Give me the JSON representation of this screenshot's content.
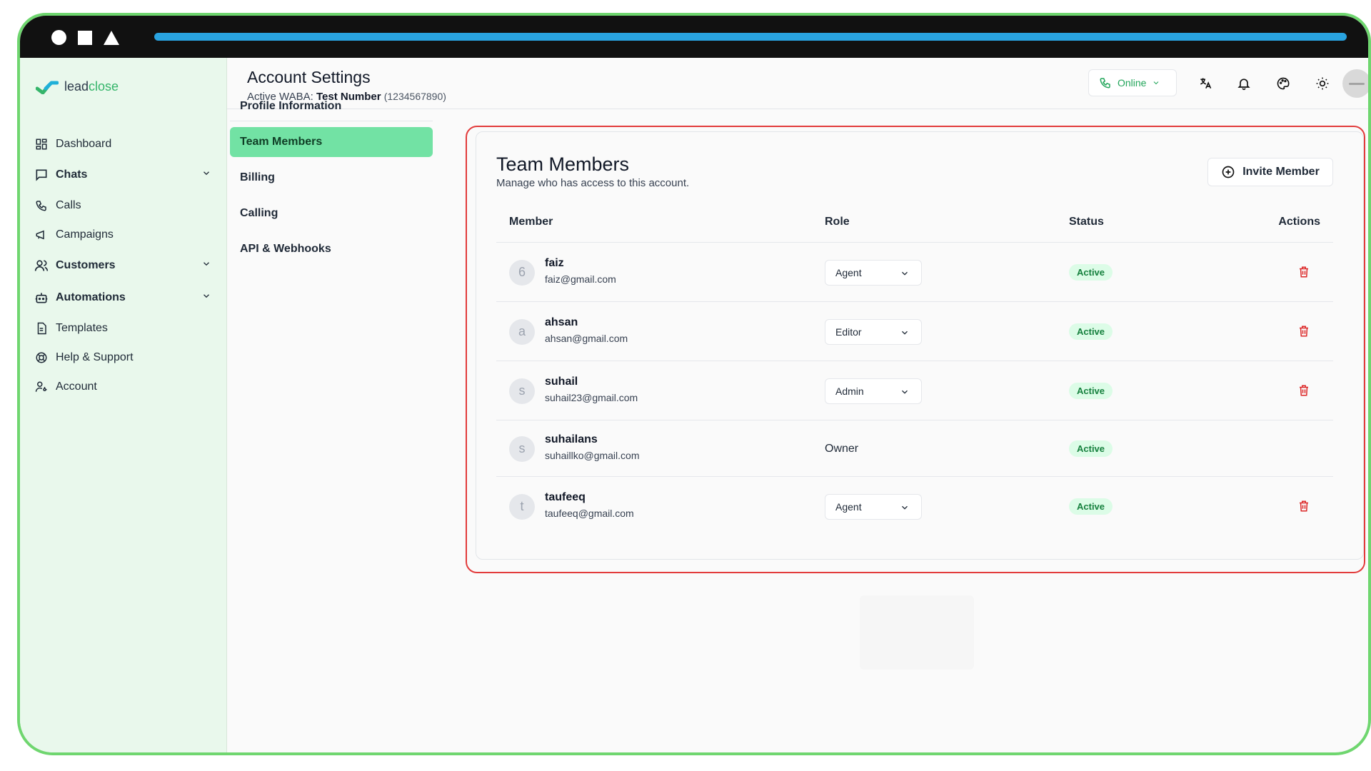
{
  "window": {
    "accent_bar_color": "#29a3e0",
    "frame_color": "#6fd66f"
  },
  "sidebar": {
    "logo": {
      "part1": "lead",
      "part2": "close"
    },
    "items": [
      {
        "label": "Dashboard",
        "icon": "grid-icon",
        "bold": false,
        "chevron": false
      },
      {
        "label": "Chats",
        "icon": "chat-icon",
        "bold": true,
        "chevron": true
      },
      {
        "label": "Calls",
        "icon": "phone-icon",
        "bold": false,
        "chevron": false
      },
      {
        "label": "Campaigns",
        "icon": "megaphone-icon",
        "bold": false,
        "chevron": false
      },
      {
        "label": "Customers",
        "icon": "users-icon",
        "bold": true,
        "chevron": true
      },
      {
        "label": "Automations",
        "icon": "bot-icon",
        "bold": true,
        "chevron": true
      },
      {
        "label": "Templates",
        "icon": "document-icon",
        "bold": false,
        "chevron": false
      },
      {
        "label": "Help & Support",
        "icon": "lifebuoy-icon",
        "bold": false,
        "chevron": false
      },
      {
        "label": "Account",
        "icon": "user-key-icon",
        "bold": false,
        "chevron": false
      }
    ]
  },
  "header": {
    "title": "Account Settings",
    "waba_label": "Active WABA:",
    "waba_name": "Test Number",
    "waba_number": "(1234567890)",
    "status_label": "Online",
    "icons": [
      "translate-icon",
      "bell-icon",
      "palette-icon",
      "sun-icon"
    ]
  },
  "settings_nav": {
    "items": [
      {
        "label": "Profile Information"
      },
      {
        "label": "Team Members",
        "active": true
      },
      {
        "label": "Billing"
      },
      {
        "label": "Calling"
      },
      {
        "label": "API & Webhooks"
      }
    ]
  },
  "team": {
    "title": "Team Members",
    "subtitle": "Manage who has access to this account.",
    "invite_label": "Invite Member",
    "columns": {
      "member": "Member",
      "role": "Role",
      "status": "Status",
      "actions": "Actions"
    },
    "rows": [
      {
        "initial": "6",
        "name": "faiz",
        "email": "faiz@gmail.com",
        "role": "Agent",
        "editable": true,
        "status": "Active"
      },
      {
        "initial": "a",
        "name": "ahsan",
        "email": "ahsan@gmail.com",
        "role": "Editor",
        "editable": true,
        "status": "Active"
      },
      {
        "initial": "s",
        "name": "suhail",
        "email": "suhail23@gmail.com",
        "role": "Admin",
        "editable": true,
        "status": "Active"
      },
      {
        "initial": "s",
        "name": "suhailans",
        "email": "suhaillko@gmail.com",
        "role": "Owner",
        "editable": false,
        "status": "Active"
      },
      {
        "initial": "t",
        "name": "taufeeq",
        "email": "taufeeq@gmail.com",
        "role": "Agent",
        "editable": true,
        "status": "Active"
      }
    ]
  }
}
